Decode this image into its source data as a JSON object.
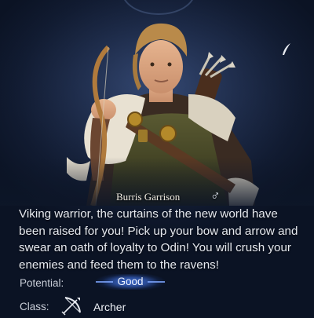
{
  "hero": {
    "name": "Burris Garrison",
    "gender_icon": "male-symbol-icon",
    "gender_glyph": "♂",
    "description": "Viking warrior, the curtains of the new world have been raised for you! Pick up your bow and arrow and swear an oath of loyalty to Odin! You will crush your enemies and feed them to the ravens!"
  },
  "stats": {
    "potential_label": "Potential:",
    "potential_value": "Good",
    "class_label": "Class:",
    "class_icon": "bow-and-arrow-icon",
    "class_value": "Archer"
  },
  "colors": {
    "background": "#0d1628",
    "potential_badge": "#2a4c98",
    "text": "#e6e9ef"
  }
}
